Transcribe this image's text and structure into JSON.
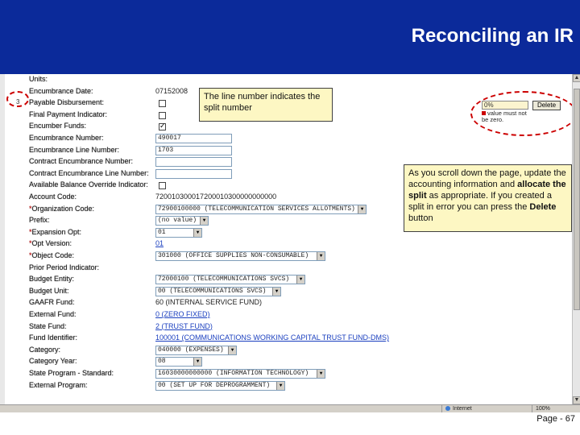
{
  "slide": {
    "title": "Reconciling an IR",
    "page_label": "Page - 67",
    "header_color": "#0b2a9a",
    "callout_color": "#fdf7c3",
    "highlight_color": "#cc0000"
  },
  "form": {
    "line_indicator": "3",
    "rows": [
      {
        "label": "Units:",
        "required": false,
        "type": "text",
        "value": ""
      },
      {
        "label": "Encumbrance Date:",
        "required": false,
        "type": "text",
        "value": "07152008"
      },
      {
        "label": "Payable Disbursement:",
        "required": false,
        "type": "checkbox",
        "checked": false
      },
      {
        "label": "Final Payment Indicator:",
        "required": false,
        "type": "checkbox",
        "checked": false
      },
      {
        "label": "Encumber Funds:",
        "required": false,
        "type": "checkbox",
        "checked": true
      },
      {
        "label": "Encumbrance Number:",
        "required": false,
        "type": "input",
        "value": "490017"
      },
      {
        "label": "Encumbrance Line Number:",
        "required": false,
        "type": "input",
        "value": "1703"
      },
      {
        "label": "Contract Encumbrance Number:",
        "required": false,
        "type": "input",
        "value": ""
      },
      {
        "label": "Contract Encumbrance Line Number:",
        "required": false,
        "type": "input",
        "value": ""
      },
      {
        "label": "Available Balance Override Indicator:",
        "required": false,
        "type": "checkbox",
        "checked": false
      },
      {
        "label": "Account Code:",
        "required": false,
        "type": "text",
        "value": "720010300017200010300000000000"
      },
      {
        "label": "Organization Code:",
        "required": true,
        "type": "select",
        "value": "72900100000 (TELECOMMUNICATION SERVICES ALLOTMENTS)"
      },
      {
        "label": "Prefix:",
        "required": false,
        "type": "select",
        "value": "(no value)"
      },
      {
        "label": "Expansion Opt:",
        "required": true,
        "type": "select",
        "value": "01"
      },
      {
        "label": "Opt Version:",
        "required": true,
        "type": "link",
        "value": "01"
      },
      {
        "label": "Object Code:",
        "required": true,
        "type": "select",
        "value": "301000 (OFFICE SUPPLIES NON-CONSUMABLE)"
      },
      {
        "label": "Prior Period Indicator:",
        "required": false,
        "type": "text",
        "value": ""
      },
      {
        "label": "Budget Entity:",
        "required": false,
        "type": "select",
        "value": "72000100 (TELECOMMUNICATIONS SVCS)"
      },
      {
        "label": "Budget Unit:",
        "required": false,
        "type": "select",
        "value": "00 (TELECOMMUNICATIONS SVCS)"
      },
      {
        "label": "GAAFR Fund:",
        "required": false,
        "type": "text",
        "value": "60 (INTERNAL SERVICE FUND)"
      },
      {
        "label": "External Fund:",
        "required": false,
        "type": "link",
        "value": "0 (ZERO FIXED)"
      },
      {
        "label": "State Fund:",
        "required": false,
        "type": "link",
        "value": "2 (TRUST FUND)"
      },
      {
        "label": "Fund Identifier:",
        "required": false,
        "type": "link",
        "value": "100001 (COMMUNICATIONS WORKING CAPITAL TRUST FUND-DMS)"
      },
      {
        "label": "Category:",
        "required": false,
        "type": "select",
        "value": "040000 (EXPENSES)"
      },
      {
        "label": "Category Year:",
        "required": false,
        "type": "select",
        "value": "08"
      },
      {
        "label": "State Program - Standard:",
        "required": false,
        "type": "select",
        "value": "16030000000000 (INFORMATION TECHNOLOGY)"
      },
      {
        "label": "External Program:",
        "required": false,
        "type": "select",
        "value": "00 (SET UP FOR DEPROGRAMMENT)"
      }
    ]
  },
  "split_panel": {
    "amount_value": "0%",
    "delete_label": "Delete",
    "error_text": "value must not be zero."
  },
  "callouts": {
    "line_number": "The line number indicates the split number",
    "scroll_hint_part1": "As you scroll down the page, update the accounting information and ",
    "scroll_hint_bold1": "allocate the split",
    "scroll_hint_part2": " as appropriate.  If you created a split in error you can press the ",
    "scroll_hint_bold2": "Delete",
    "scroll_hint_part3": " button"
  },
  "status_bar": {
    "zone_label": "Internet",
    "zoom_label": "100%"
  }
}
